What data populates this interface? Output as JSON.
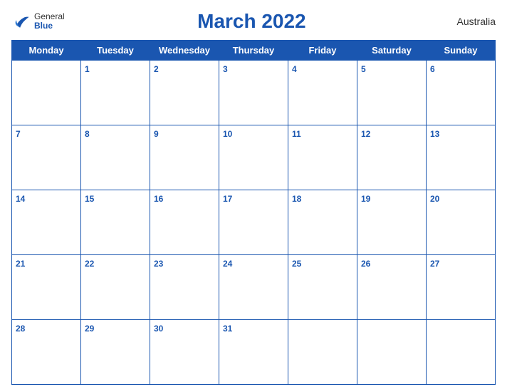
{
  "header": {
    "logo_general": "General",
    "logo_blue": "Blue",
    "title": "March 2022",
    "country": "Australia"
  },
  "days_of_week": [
    "Monday",
    "Tuesday",
    "Wednesday",
    "Thursday",
    "Friday",
    "Saturday",
    "Sunday"
  ],
  "weeks": [
    [
      null,
      1,
      2,
      3,
      4,
      5,
      6
    ],
    [
      7,
      8,
      9,
      10,
      11,
      12,
      13
    ],
    [
      14,
      15,
      16,
      17,
      18,
      19,
      20
    ],
    [
      21,
      22,
      23,
      24,
      25,
      26,
      27
    ],
    [
      28,
      29,
      30,
      31,
      null,
      null,
      null
    ]
  ]
}
